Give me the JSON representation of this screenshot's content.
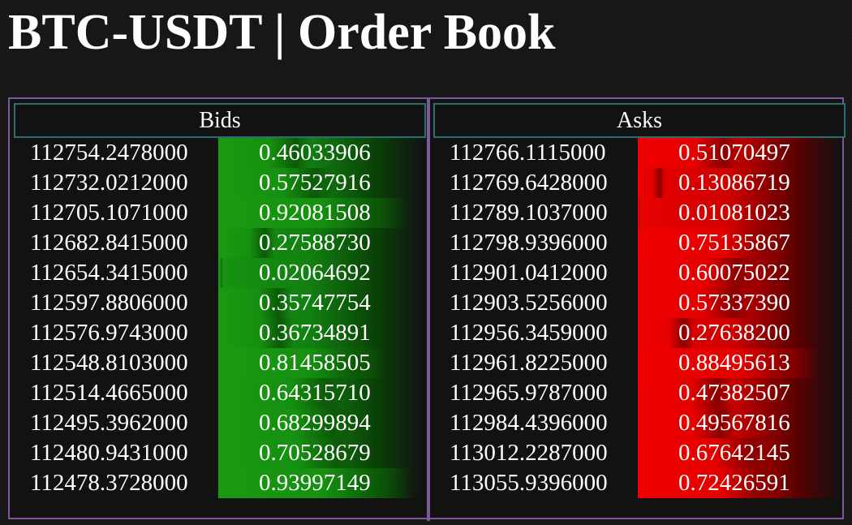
{
  "page": {
    "title": "BTC-USDT | Order Book"
  },
  "colors": {
    "background": "#181818",
    "frame_border": "#7b5a9a",
    "header_border": "#2f6e6e",
    "bid_bar": "#169410",
    "ask_bar": "#e80000",
    "text": "#ffffff"
  },
  "bids": {
    "header": "Bids",
    "rows": [
      {
        "price": "112754.2478000",
        "size": "0.46033906"
      },
      {
        "price": "112732.0212000",
        "size": "0.57527916"
      },
      {
        "price": "112705.1071000",
        "size": "0.92081508"
      },
      {
        "price": "112682.8415000",
        "size": "0.27588730"
      },
      {
        "price": "112654.3415000",
        "size": "0.02064692"
      },
      {
        "price": "112597.8806000",
        "size": "0.35747754"
      },
      {
        "price": "112576.9743000",
        "size": "0.36734891"
      },
      {
        "price": "112548.8103000",
        "size": "0.81458505"
      },
      {
        "price": "112514.4665000",
        "size": "0.64315710"
      },
      {
        "price": "112495.3962000",
        "size": "0.68299894"
      },
      {
        "price": "112480.9431000",
        "size": "0.70528679"
      },
      {
        "price": "112478.3728000",
        "size": "0.93997149"
      }
    ]
  },
  "asks": {
    "header": "Asks",
    "rows": [
      {
        "price": "112766.1115000",
        "size": "0.51070497"
      },
      {
        "price": "112769.6428000",
        "size": "0.13086719"
      },
      {
        "price": "112789.1037000",
        "size": "0.01081023"
      },
      {
        "price": "112798.9396000",
        "size": "0.75135867"
      },
      {
        "price": "112901.0412000",
        "size": "0.60075022"
      },
      {
        "price": "112903.5256000",
        "size": "0.57337390"
      },
      {
        "price": "112956.3459000",
        "size": "0.27638200"
      },
      {
        "price": "112961.8225000",
        "size": "0.88495613"
      },
      {
        "price": "112965.9787000",
        "size": "0.47382507"
      },
      {
        "price": "112984.4396000",
        "size": "0.49567816"
      },
      {
        "price": "113012.2287000",
        "size": "0.67642145"
      },
      {
        "price": "113055.9396000",
        "size": "0.72426591"
      }
    ]
  }
}
